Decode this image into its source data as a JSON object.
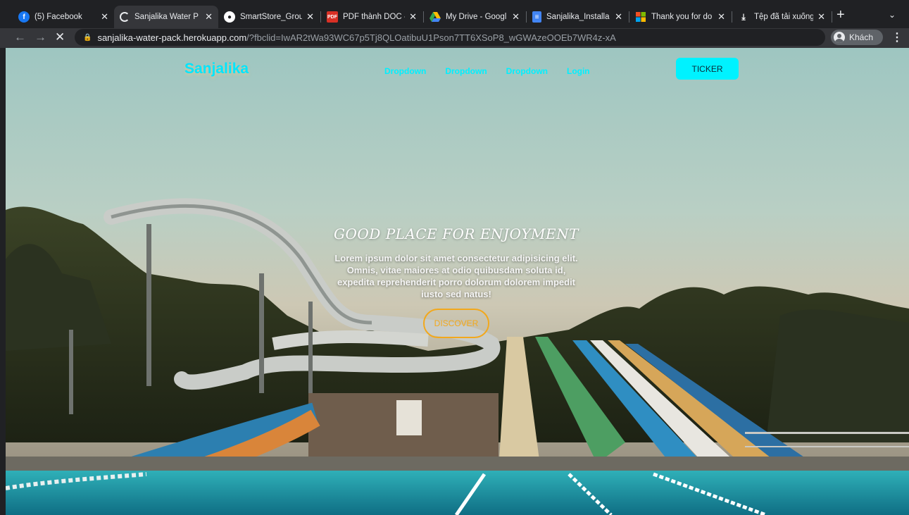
{
  "browser": {
    "tabs": [
      {
        "title": "(5) Facebook",
        "icon": "facebook-icon",
        "color": "#1877f2"
      },
      {
        "title": "Sanjalika Water P",
        "icon": "loading-spinner-icon",
        "color": "#e8eaed"
      },
      {
        "title": "SmartStore_Grou",
        "icon": "github-icon",
        "color": "#ffffff"
      },
      {
        "title": "PDF thành DOC -",
        "icon": "pdf-to-doc-icon",
        "color": "#d93025"
      },
      {
        "title": "My Drive - Googl",
        "icon": "google-drive-icon",
        "color": "#fbbc04"
      },
      {
        "title": "Sanjalika_Installa",
        "icon": "google-docs-icon",
        "color": "#4285f4"
      },
      {
        "title": "Thank you for do",
        "icon": "microsoft-icon",
        "color": "#f25022"
      },
      {
        "title": "Tệp đã tải xuống",
        "icon": "download-icon",
        "color": "#e8eaed"
      }
    ],
    "new_tab_symbol": "+",
    "url_host": "sanjalika-water-pack.herokuapp.com",
    "url_path": "/?fbclid=IwAR2tWa93WC67p5Tj8QLOatibuU1Pson7TT6XSoP8_wGWAzeOOEb7WR4z-xA",
    "profile_label": "Khách"
  },
  "site": {
    "logo": "Sanjalika",
    "nav": [
      "Dropdown",
      "Dropdown",
      "Dropdown",
      "Login"
    ],
    "ticker_label": "TICKER",
    "hero_title": "GOOD PLACE FOR ENJOYMENT",
    "hero_text": "Lorem ipsum dolor sit amet consectetur adipisicing elit. Omnis, vitae maiores at odio quibusdam soluta id, expedita reprehenderit porro dolorum dolorem impedit iusto sed natus!",
    "discover_label": "DISCOVER"
  },
  "colors": {
    "accent_cyan": "#00f2ff",
    "discover_orange": "#f2a81c",
    "chrome_dark": "#202124"
  }
}
